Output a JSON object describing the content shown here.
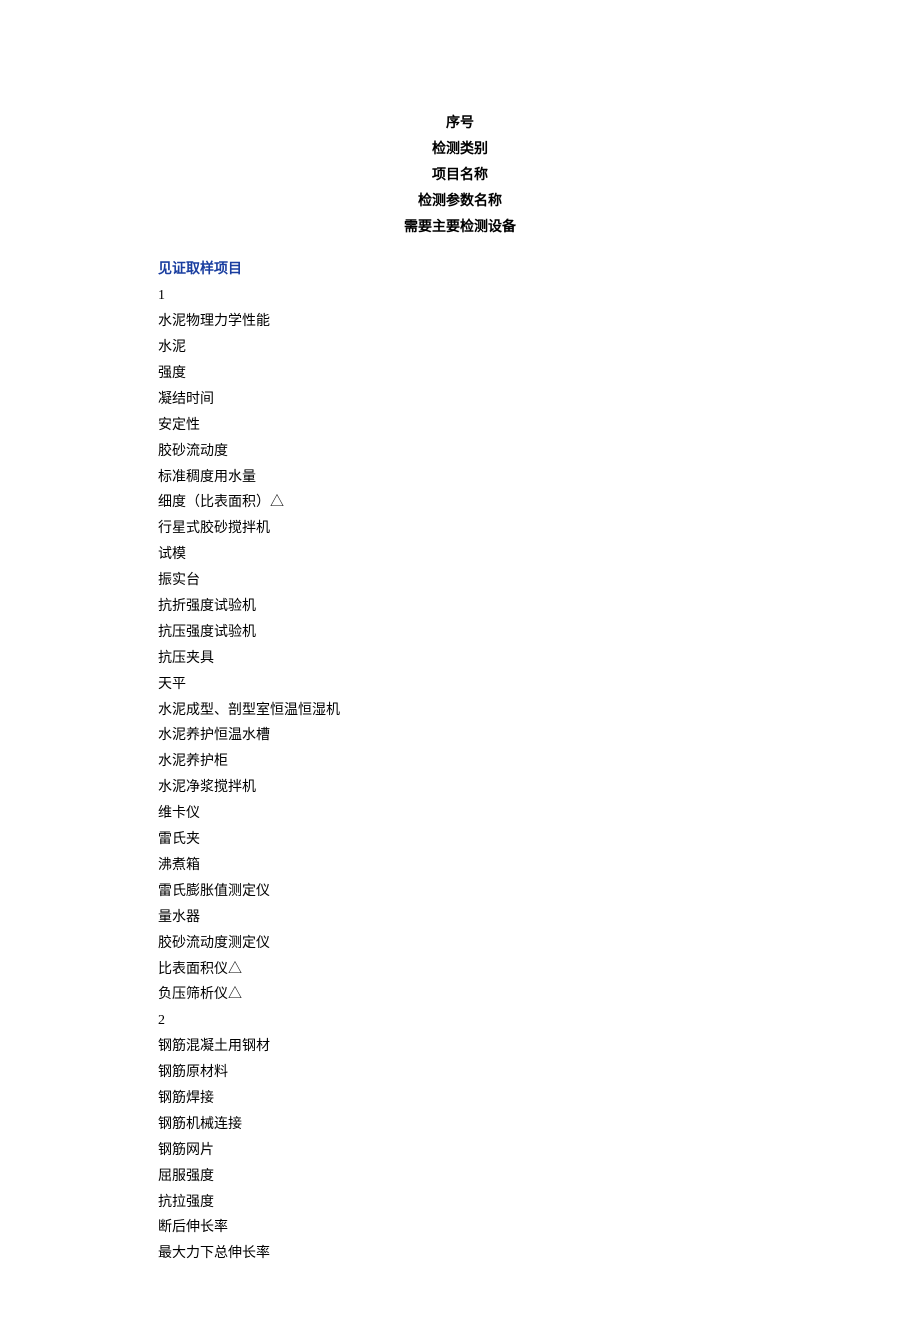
{
  "header": {
    "col1": "序号",
    "col2": "检测类别",
    "col3": "项目名称",
    "col4": "检测参数名称",
    "col5": "需要主要检测设备"
  },
  "section_title": "见证取样项目",
  "lines": {
    "l0": "1",
    "l1": "水泥物理力学性能",
    "l2": "水泥",
    "l3": "强度",
    "l4": "凝结时间",
    "l5": "安定性",
    "l6": "胶砂流动度",
    "l7": "标准稠度用水量",
    "l8": "细度（比表面积）△",
    "l9": "行星式胶砂搅拌机",
    "l10": "试模",
    "l11": "振实台",
    "l12": "抗折强度试验机",
    "l13": "抗压强度试验机",
    "l14": "抗压夹具",
    "l15": "天平",
    "l16": "水泥成型、剖型室恒温恒湿机",
    "l17": "水泥养护恒温水槽",
    "l18": "水泥养护柜",
    "l19": "水泥净浆搅拌机",
    "l20": "维卡仪",
    "l21": "雷氏夹",
    "l22": "沸煮箱",
    "l23": "雷氏膨胀值测定仪",
    "l24": "量水器",
    "l25": "胶砂流动度测定仪",
    "l26": "比表面积仪△",
    "l27": "负压筛析仪△",
    "l28": "2",
    "l29": "钢筋混凝土用钢材",
    "l30": "钢筋原材料",
    "l31": "钢筋焊接",
    "l32": "钢筋机械连接",
    "l33": "钢筋网片",
    "l34": "屈服强度",
    "l35": "抗拉强度",
    "l36": "断后伸长率",
    "l37": "最大力下总伸长率"
  }
}
